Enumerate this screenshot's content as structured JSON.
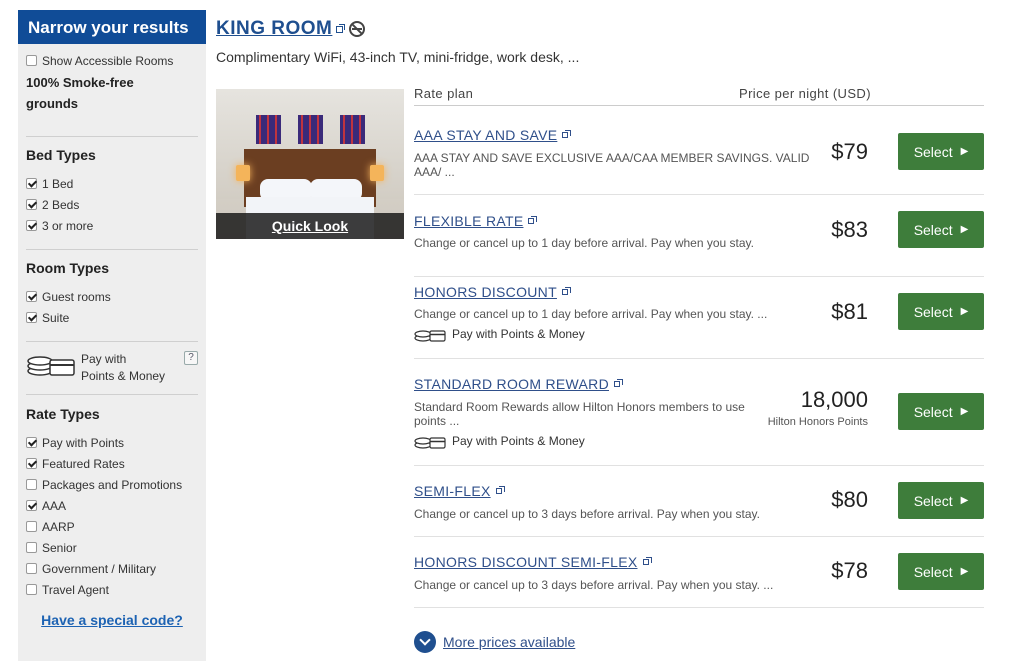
{
  "sidebar": {
    "header": "Narrow your results",
    "accessible": {
      "label": "Show Accessible Rooms",
      "checked": false
    },
    "smoke_free": "100% Smoke-free grounds",
    "bed_types": {
      "title": "Bed Types",
      "items": [
        {
          "label": "1 Bed",
          "checked": true
        },
        {
          "label": "2 Beds",
          "checked": true
        },
        {
          "label": "3 or more",
          "checked": true
        }
      ]
    },
    "room_types": {
      "title": "Room Types",
      "items": [
        {
          "label": "Guest rooms",
          "checked": true
        },
        {
          "label": "Suite",
          "checked": true
        }
      ]
    },
    "pay_points": {
      "line1": "Pay with",
      "line2": "Points & Money",
      "help": "?"
    },
    "rate_types": {
      "title": "Rate Types",
      "items": [
        {
          "label": "Pay with Points",
          "checked": true
        },
        {
          "label": "Featured Rates",
          "checked": true
        },
        {
          "label": "Packages and Promotions",
          "checked": false
        },
        {
          "label": "AAA",
          "checked": true
        },
        {
          "label": "AARP",
          "checked": false
        },
        {
          "label": "Senior",
          "checked": false
        },
        {
          "label": "Government / Military",
          "checked": false
        },
        {
          "label": "Travel Agent",
          "checked": false
        }
      ]
    },
    "special_code": "Have a special code?"
  },
  "room": {
    "title": "KING ROOM",
    "description": "Complimentary WiFi, 43-inch TV, mini-fridge, work desk, ...",
    "quick_look": "Quick Look"
  },
  "rates": {
    "header_plan": "Rate plan",
    "header_price": "Price per night (USD)",
    "select_label": "Select",
    "pm_label": "Pay with Points & Money",
    "rows": [
      {
        "name": "AAA STAY AND SAVE",
        "desc": "AAA STAY AND SAVE EXCLUSIVE AAA/CAA MEMBER SAVINGS. VALID AAA/ ...",
        "price": "$79"
      },
      {
        "name": "FLEXIBLE RATE",
        "desc": "Change or cancel up to 1 day before arrival. Pay when you stay.",
        "price": "$83"
      },
      {
        "name": "HONORS DISCOUNT",
        "desc": "Change or cancel up to 1 day before arrival. Pay when you stay. ...",
        "price": "$81"
      },
      {
        "name": "STANDARD ROOM REWARD",
        "desc": "Standard Room Rewards allow Hilton Honors members to use points ...",
        "price": "18,000",
        "price_sub": "Hilton Honors Points"
      },
      {
        "name": "SEMI-FLEX",
        "desc": "Change or cancel up to 3 days before arrival. Pay when you stay.",
        "price": "$80"
      },
      {
        "name": "HONORS DISCOUNT SEMI-FLEX",
        "desc": "Change or cancel up to 3 days before arrival. Pay when you stay. ...",
        "price": "$78"
      }
    ],
    "more_prices": "More prices available"
  },
  "colors": {
    "brand_blue": "#104c97",
    "select_green": "#3e7d3b",
    "link_blue": "#2f4f8a"
  }
}
